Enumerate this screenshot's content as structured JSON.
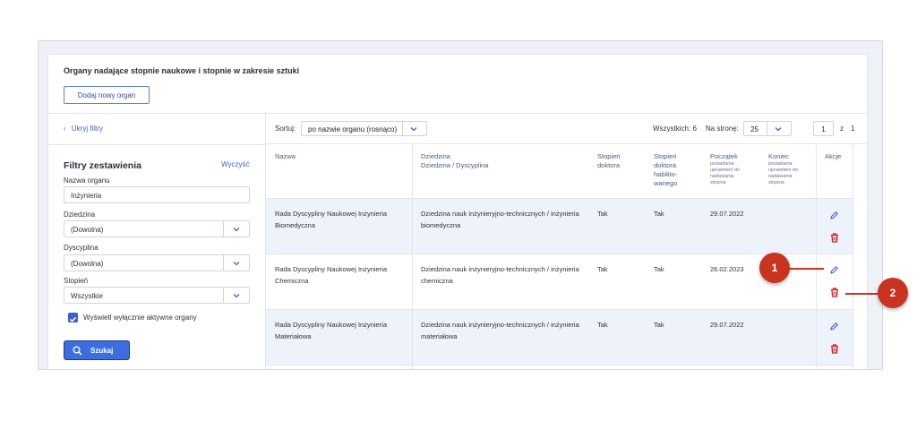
{
  "header": {
    "title": "Organy nadające stopnie naukowe i stopnie w zakresie sztuki",
    "add_button": "Dodaj nowy organ"
  },
  "filters": {
    "hide_link": "Ukryj filtry",
    "title": "Filtry zestawienia",
    "clear_link": "Wyczyść",
    "organ_name_label": "Nazwa organu",
    "organ_name_value": "Inżynieria",
    "domain_label": "Dziedzina",
    "domain_value": "(Dowolna)",
    "discipline_label": "Dyscyplina",
    "discipline_value": "(Dowolna)",
    "degree_label": "Stopień",
    "degree_value": "Wszystkie",
    "active_only_label": "Wyświetl wyłącznie aktywne organy",
    "active_only_checked": true,
    "search_button": "Szukaj"
  },
  "toolbar": {
    "sort_label": "Sortuj:",
    "sort_value": "po nazwie organu (rosnąco)",
    "total_label": "Wszystkich: 6",
    "per_page_label": "Na stronę:",
    "per_page_value": "25",
    "page_current": "1",
    "page_of": "z",
    "page_total": "1"
  },
  "table": {
    "headers": {
      "name": "Nazwa",
      "domain": "Dziedzina",
      "domain_sub": "Dziedzina / Dyscyplina",
      "doctor_1": "Stopień",
      "doctor_2": "doktora",
      "hab_1": "Stopień",
      "hab_2": "doktora",
      "hab_3": "habilito-",
      "hab_4": "wanego",
      "start": "Początek",
      "start_sub_1": "posiadania",
      "start_sub_2": "uprawnień do",
      "start_sub_3": "nadawania",
      "start_sub_4": "stopnia",
      "end": "Koniec",
      "end_sub_1": "posiadania",
      "end_sub_2": "uprawnień do",
      "end_sub_3": "nadawania",
      "end_sub_4": "stopnia",
      "actions": "Akcje"
    },
    "rows": [
      {
        "name_1": "Rada Dyscypliny Naukowej  Inżynieria",
        "name_2": "Biomedyczna",
        "domain_1": "Dziedzina nauk inżynieryjno-technicznych / inżynieria",
        "domain_2": "biomedyczna",
        "doctor": "Tak",
        "hab": "Tak",
        "start": "29.07.2022",
        "end": ""
      },
      {
        "name_1": "Rada Dyscypliny Naukowej  Inżynieria",
        "name_2": "Chemiczna",
        "domain_1": "Dziedzina nauk inżynieryjno-technicznych / inżynieria",
        "domain_2": "chemiczna",
        "doctor": "Tak",
        "hab": "Tak",
        "start": "26.02.2023",
        "end": ""
      },
      {
        "name_1": "Rada Dyscypliny Naukowej  Inżynieria",
        "name_2": "Materiałowa",
        "domain_1": "Dziedzina nauk inżynieryjno-technicznych / inżynieria",
        "domain_2": "materiałowa",
        "doctor": "Tak",
        "hab": "Tak",
        "start": "29.07.2022",
        "end": ""
      }
    ]
  },
  "callouts": {
    "one": "1",
    "two": "2"
  },
  "icons": {
    "edit": "pencil-icon",
    "delete": "trash-icon",
    "search": "search-icon",
    "chevron": "chevron-down-icon",
    "back": "chevron-left-icon"
  },
  "colors": {
    "accent": "#3d6ee0",
    "link": "#3d63c9",
    "delete": "#d0202a",
    "callout": "#c8341f"
  }
}
